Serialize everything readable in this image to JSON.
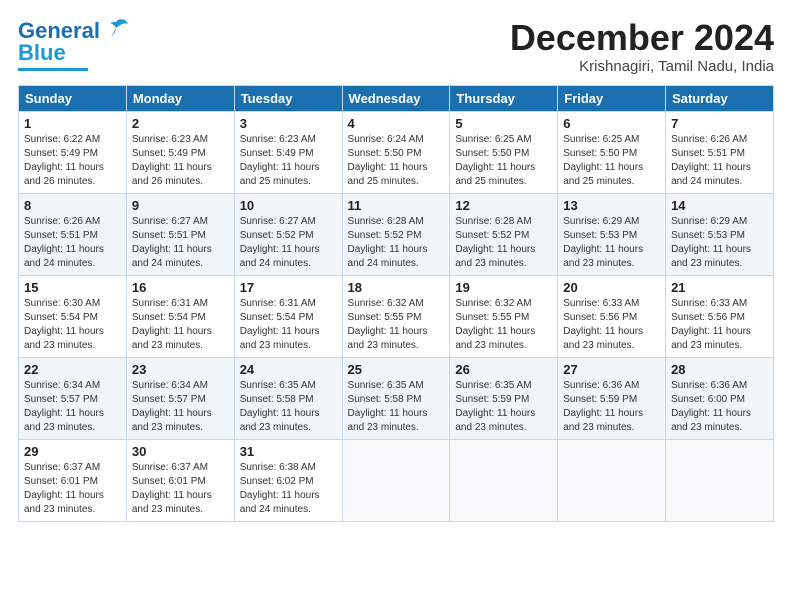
{
  "logo": {
    "text_general": "General",
    "text_blue": "Blue"
  },
  "title": {
    "month": "December 2024",
    "location": "Krishnagiri, Tamil Nadu, India"
  },
  "days_of_week": [
    "Sunday",
    "Monday",
    "Tuesday",
    "Wednesday",
    "Thursday",
    "Friday",
    "Saturday"
  ],
  "weeks": [
    [
      {
        "day": "1",
        "info": "Sunrise: 6:22 AM\nSunset: 5:49 PM\nDaylight: 11 hours\nand 26 minutes."
      },
      {
        "day": "2",
        "info": "Sunrise: 6:23 AM\nSunset: 5:49 PM\nDaylight: 11 hours\nand 26 minutes."
      },
      {
        "day": "3",
        "info": "Sunrise: 6:23 AM\nSunset: 5:49 PM\nDaylight: 11 hours\nand 25 minutes."
      },
      {
        "day": "4",
        "info": "Sunrise: 6:24 AM\nSunset: 5:50 PM\nDaylight: 11 hours\nand 25 minutes."
      },
      {
        "day": "5",
        "info": "Sunrise: 6:25 AM\nSunset: 5:50 PM\nDaylight: 11 hours\nand 25 minutes."
      },
      {
        "day": "6",
        "info": "Sunrise: 6:25 AM\nSunset: 5:50 PM\nDaylight: 11 hours\nand 25 minutes."
      },
      {
        "day": "7",
        "info": "Sunrise: 6:26 AM\nSunset: 5:51 PM\nDaylight: 11 hours\nand 24 minutes."
      }
    ],
    [
      {
        "day": "8",
        "info": "Sunrise: 6:26 AM\nSunset: 5:51 PM\nDaylight: 11 hours\nand 24 minutes."
      },
      {
        "day": "9",
        "info": "Sunrise: 6:27 AM\nSunset: 5:51 PM\nDaylight: 11 hours\nand 24 minutes."
      },
      {
        "day": "10",
        "info": "Sunrise: 6:27 AM\nSunset: 5:52 PM\nDaylight: 11 hours\nand 24 minutes."
      },
      {
        "day": "11",
        "info": "Sunrise: 6:28 AM\nSunset: 5:52 PM\nDaylight: 11 hours\nand 24 minutes."
      },
      {
        "day": "12",
        "info": "Sunrise: 6:28 AM\nSunset: 5:52 PM\nDaylight: 11 hours\nand 23 minutes."
      },
      {
        "day": "13",
        "info": "Sunrise: 6:29 AM\nSunset: 5:53 PM\nDaylight: 11 hours\nand 23 minutes."
      },
      {
        "day": "14",
        "info": "Sunrise: 6:29 AM\nSunset: 5:53 PM\nDaylight: 11 hours\nand 23 minutes."
      }
    ],
    [
      {
        "day": "15",
        "info": "Sunrise: 6:30 AM\nSunset: 5:54 PM\nDaylight: 11 hours\nand 23 minutes."
      },
      {
        "day": "16",
        "info": "Sunrise: 6:31 AM\nSunset: 5:54 PM\nDaylight: 11 hours\nand 23 minutes."
      },
      {
        "day": "17",
        "info": "Sunrise: 6:31 AM\nSunset: 5:54 PM\nDaylight: 11 hours\nand 23 minutes."
      },
      {
        "day": "18",
        "info": "Sunrise: 6:32 AM\nSunset: 5:55 PM\nDaylight: 11 hours\nand 23 minutes."
      },
      {
        "day": "19",
        "info": "Sunrise: 6:32 AM\nSunset: 5:55 PM\nDaylight: 11 hours\nand 23 minutes."
      },
      {
        "day": "20",
        "info": "Sunrise: 6:33 AM\nSunset: 5:56 PM\nDaylight: 11 hours\nand 23 minutes."
      },
      {
        "day": "21",
        "info": "Sunrise: 6:33 AM\nSunset: 5:56 PM\nDaylight: 11 hours\nand 23 minutes."
      }
    ],
    [
      {
        "day": "22",
        "info": "Sunrise: 6:34 AM\nSunset: 5:57 PM\nDaylight: 11 hours\nand 23 minutes."
      },
      {
        "day": "23",
        "info": "Sunrise: 6:34 AM\nSunset: 5:57 PM\nDaylight: 11 hours\nand 23 minutes."
      },
      {
        "day": "24",
        "info": "Sunrise: 6:35 AM\nSunset: 5:58 PM\nDaylight: 11 hours\nand 23 minutes."
      },
      {
        "day": "25",
        "info": "Sunrise: 6:35 AM\nSunset: 5:58 PM\nDaylight: 11 hours\nand 23 minutes."
      },
      {
        "day": "26",
        "info": "Sunrise: 6:35 AM\nSunset: 5:59 PM\nDaylight: 11 hours\nand 23 minutes."
      },
      {
        "day": "27",
        "info": "Sunrise: 6:36 AM\nSunset: 5:59 PM\nDaylight: 11 hours\nand 23 minutes."
      },
      {
        "day": "28",
        "info": "Sunrise: 6:36 AM\nSunset: 6:00 PM\nDaylight: 11 hours\nand 23 minutes."
      }
    ],
    [
      {
        "day": "29",
        "info": "Sunrise: 6:37 AM\nSunset: 6:01 PM\nDaylight: 11 hours\nand 23 minutes."
      },
      {
        "day": "30",
        "info": "Sunrise: 6:37 AM\nSunset: 6:01 PM\nDaylight: 11 hours\nand 23 minutes."
      },
      {
        "day": "31",
        "info": "Sunrise: 6:38 AM\nSunset: 6:02 PM\nDaylight: 11 hours\nand 24 minutes."
      },
      {
        "day": "",
        "info": ""
      },
      {
        "day": "",
        "info": ""
      },
      {
        "day": "",
        "info": ""
      },
      {
        "day": "",
        "info": ""
      }
    ]
  ]
}
